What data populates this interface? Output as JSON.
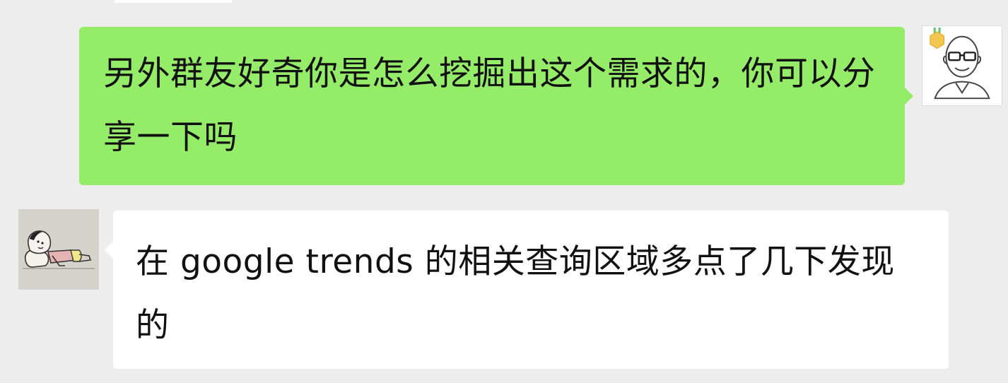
{
  "chat": {
    "messages": [
      {
        "sender": "self",
        "text": "另外群友好奇你是怎么挖掘出这个需求的，你可以分享一下吗"
      },
      {
        "sender": "other",
        "text": "在 google trends 的相关查询区域多点了几下发现的"
      }
    ]
  },
  "colors": {
    "background": "#ededed",
    "outgoing_bubble": "#95ec69",
    "incoming_bubble": "#ffffff",
    "text": "#111111"
  },
  "icons": {
    "self_avatar": "bald-man-glasses-avatar-icon",
    "self_badge": "gold-badge-icon",
    "other_avatar": "cartoon-boy-lying-avatar-icon"
  }
}
